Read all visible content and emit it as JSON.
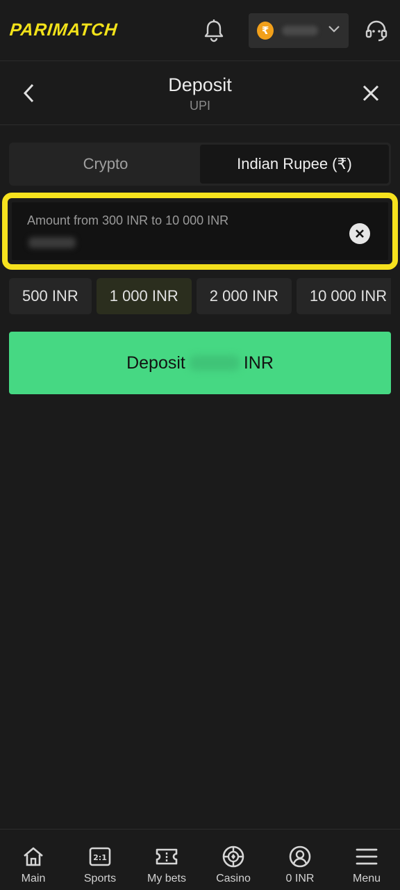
{
  "header": {
    "logo": "PARIMATCH",
    "currency_symbol": "₹",
    "icons": [
      "bell-icon",
      "chevron-down-icon",
      "headset-icon"
    ]
  },
  "dialog": {
    "title": "Deposit",
    "subtitle": "UPI",
    "icons": [
      "chevron-left-icon",
      "close-icon"
    ]
  },
  "tabs": [
    {
      "label": "Crypto",
      "active": false
    },
    {
      "label": "Indian Rupee (₹)",
      "active": true
    }
  ],
  "amount": {
    "label": "Amount from 300 INR to 10 000 INR",
    "highlight_color": "#f6e21e"
  },
  "presets": [
    {
      "label": "500 INR",
      "selected": false
    },
    {
      "label": "1 000 INR",
      "selected": true
    },
    {
      "label": "2 000 INR",
      "selected": false
    },
    {
      "label": "10 000 INR",
      "selected": false
    }
  ],
  "deposit_button": {
    "prefix": "Deposit",
    "suffix": "INR",
    "color": "#46d883"
  },
  "bottom_nav": [
    {
      "label": "Main",
      "icon": "home-icon"
    },
    {
      "label": "Sports",
      "icon": "scoreboard-icon"
    },
    {
      "label": "My bets",
      "icon": "ticket-icon"
    },
    {
      "label": "Casino",
      "icon": "chip-icon"
    },
    {
      "label": "0 INR",
      "icon": "account-icon"
    },
    {
      "label": "Menu",
      "icon": "menu-icon"
    }
  ]
}
